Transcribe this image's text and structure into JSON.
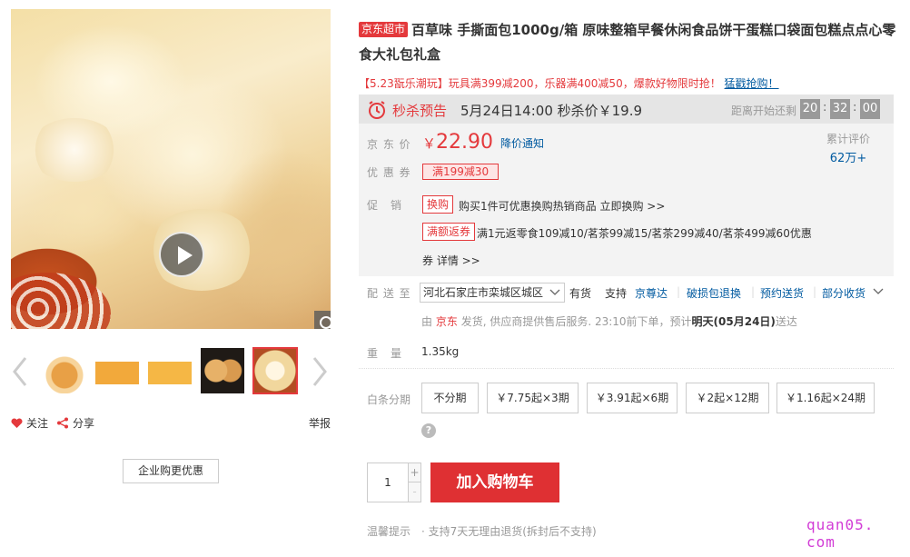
{
  "product": {
    "tag": "京东超市",
    "title": "百草味 手撕面包1000g/箱 原味整箱早餐休闲食品饼干蛋糕口袋面包糕点点心零食大礼包礼盒"
  },
  "promo": {
    "text": "【5.23翫乐潮玩】玩具满399减200，乐器满400减50，爆款好物限时抢！",
    "link": "猛戳抢购！"
  },
  "flash_sale": {
    "label": "秒杀预告",
    "when": "5月24日14:00  秒杀价￥19.9",
    "countdown_label": "距离开始还剩",
    "hours": "20",
    "minutes": "32",
    "seconds": "00"
  },
  "price": {
    "label": "京 东 价",
    "currency": "￥",
    "value": "22.90",
    "notify": "降价通知"
  },
  "reviews": {
    "label": "累计评价",
    "count": "62万+"
  },
  "coupon": {
    "label": "优 惠 券",
    "value": "满199减30"
  },
  "promotions": {
    "label": "促　销",
    "items": [
      {
        "tag": "换购",
        "text": "购买1件可优惠换购热销商品 立即换购 >>"
      },
      {
        "tag": "满额返券",
        "text": "满1元返零食109减10/茗茶99减15/茗茶299减40/茗茶499减60优惠"
      }
    ],
    "more": "券 详情 >>"
  },
  "delivery": {
    "label": "配 送 至",
    "address": "河北石家庄市栾城区城区",
    "stock": "有货",
    "support": "支持",
    "services": [
      "京尊达",
      "破损包退换",
      "预约送货",
      "部分收货"
    ],
    "ship_prefix": "由",
    "ship_seller": "京东",
    "ship_mid": "发货, 供应商提供售后服务. 23:10前下单，预计",
    "ship_date": "明天(05月24日)",
    "ship_suffix": "送达"
  },
  "weight": {
    "label": "重　量",
    "value": "1.35kg"
  },
  "installments": {
    "label": "白条分期",
    "options": [
      "不分期",
      "￥7.75起×3期",
      "￥3.91起×6期",
      "￥2起×12期",
      "￥1.16起×24期"
    ]
  },
  "quantity": {
    "value": "1",
    "plus": "+",
    "minus": "-"
  },
  "cart": {
    "label": "加入购物车"
  },
  "tips": {
    "label": "温馨提示",
    "text": "· 支持7天无理由退货(拆封后不支持)"
  },
  "gallery": {
    "follow": "关注",
    "share": "分享",
    "report": "举报",
    "enterprise": "企业购更优惠"
  },
  "watermark": "quan05. com",
  "colors": {
    "accent": "#e4393c",
    "link": "#005aa0",
    "cart": "#df3033"
  },
  "icons": [
    "play-icon",
    "zoom-icon",
    "chevron-left-icon",
    "chevron-right-icon",
    "heart-icon",
    "share-icon",
    "alarm-clock-icon",
    "chevron-down-icon",
    "question-icon"
  ]
}
